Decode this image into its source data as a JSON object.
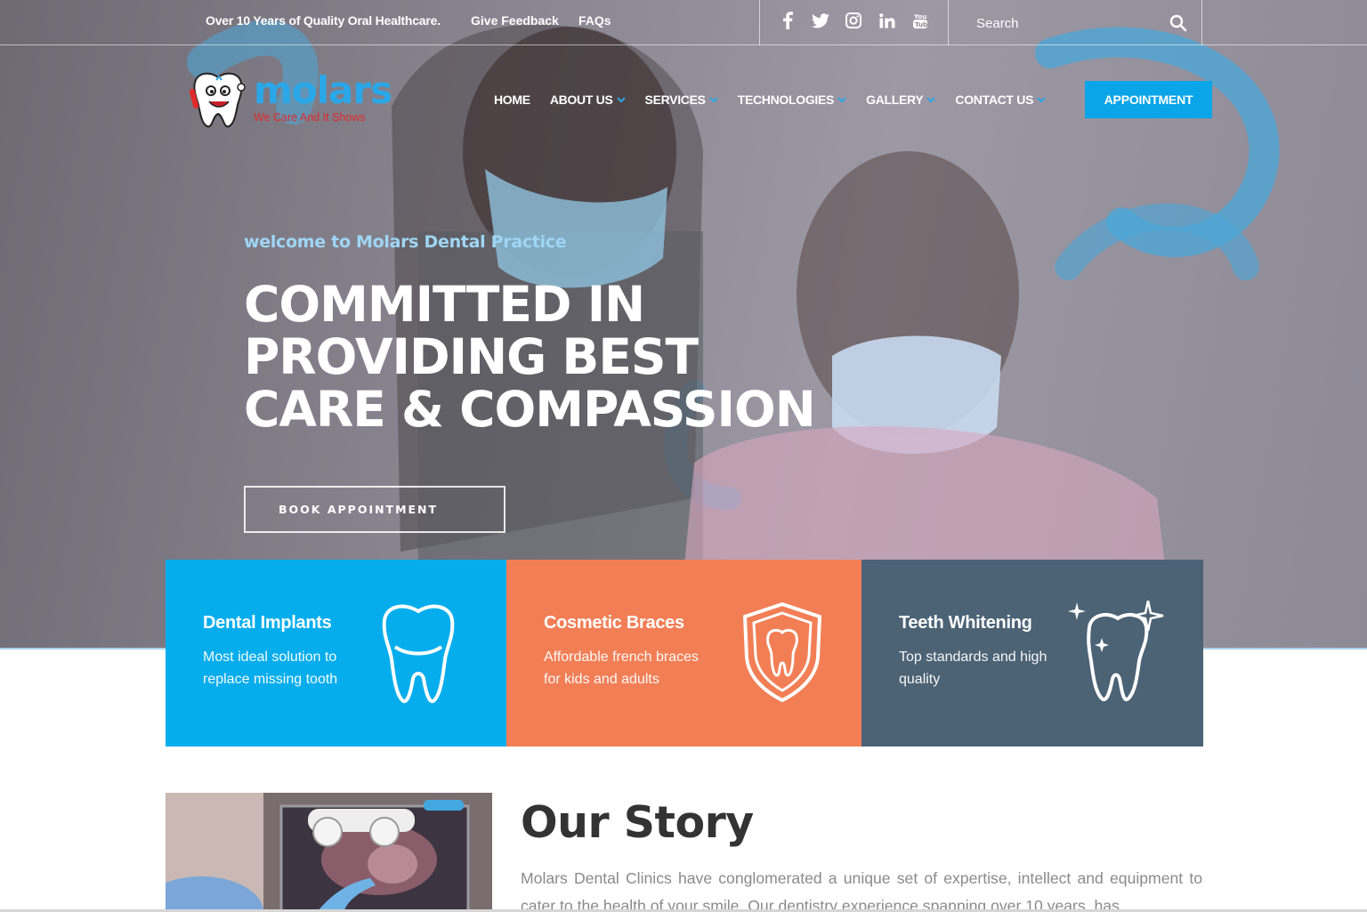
{
  "topbar": {
    "tagline": "Over 10 Years of Quality Oral Healthcare.",
    "feedback_link": "Give Feedback",
    "faqs_link": "FAQs",
    "social": [
      "facebook-icon",
      "twitter-icon",
      "instagram-icon",
      "linkedin-icon",
      "youtube-icon"
    ],
    "search_placeholder": "Search"
  },
  "logo": {
    "word": "molars",
    "slogan": "We Care And It Shows"
  },
  "nav": {
    "items": [
      {
        "label": "HOME",
        "has_dropdown": false
      },
      {
        "label": "ABOUT US",
        "has_dropdown": true
      },
      {
        "label": "SERVICES",
        "has_dropdown": true
      },
      {
        "label": "TECHNOLOGIES",
        "has_dropdown": true
      },
      {
        "label": "GALLERY",
        "has_dropdown": true
      },
      {
        "label": "CONTACT US",
        "has_dropdown": true
      }
    ],
    "appointment_label": "APPOINTMENT"
  },
  "hero": {
    "welcome": "welcome to Molars Dental Practice",
    "headline": [
      "COMMITTED IN",
      "PROVIDING BEST",
      "CARE & COMPASSION"
    ],
    "cta_label": "BOOK APPOINTMENT"
  },
  "cards": [
    {
      "title": "Dental Implants",
      "desc": "Most ideal solution to replace missing tooth",
      "color": "#05aded",
      "icon": "tooth-implant-icon"
    },
    {
      "title": "Cosmetic Braces",
      "desc": "Affordable french braces for kids and adults",
      "color": "#f27e55",
      "icon": "tooth-shield-icon"
    },
    {
      "title": "Teeth Whitening",
      "desc": "Top standards and high quality",
      "color": "#4c6275",
      "icon": "sparkling-tooth-icon"
    }
  ],
  "story": {
    "title": "Our Story",
    "text": "Molars Dental Clinics have conglomerated a unique set of expertise, intellect and equipment to cater to the health of your smile. Our dentistry experience spanning over 10 years, has"
  },
  "colors": {
    "accent_blue": "#0aa4e8",
    "logo_blue": "#2aa7e8",
    "logo_red": "#e02a2a",
    "card_orange": "#f27e55",
    "card_slate": "#4c6275"
  }
}
